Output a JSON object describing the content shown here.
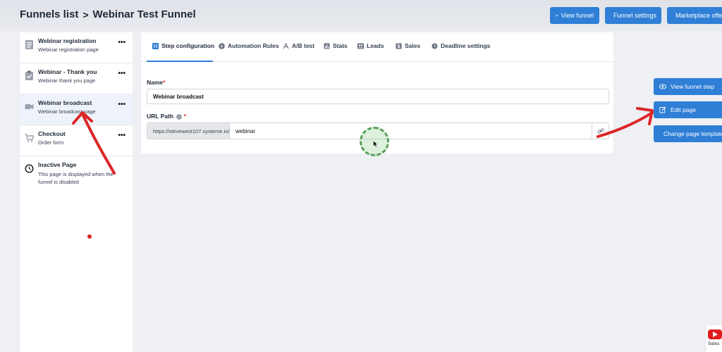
{
  "header": {
    "breadcrumb_root": "Funnels list",
    "breadcrumb_separator": ">",
    "breadcrumb_current": "Webinar Test Funnel",
    "buttons": {
      "view_funnel": "View funnel",
      "funnel_settings": "Funnel settings",
      "marketplace": "Marketplace offe"
    }
  },
  "sidebar": {
    "items": [
      {
        "title": "Webinar registration",
        "subtitle": "Webinar registration page",
        "icon": "page-icon",
        "menu": "•••"
      },
      {
        "title": "Webinar - Thank you",
        "subtitle": "Webinar thank you page",
        "icon": "clipboard-check-icon",
        "menu": "•••"
      },
      {
        "title": "Webinar broadcast",
        "subtitle": "Webinar broadcast page",
        "icon": "video-camera-icon",
        "menu": "•••"
      },
      {
        "title": "Checkout",
        "subtitle": "Order form",
        "icon": "cart-icon",
        "menu": "•••"
      },
      {
        "title": "Inactive Page",
        "subtitle": "This page is displayed when the funnel is disabled",
        "icon": "clock-icon"
      }
    ]
  },
  "tabs": [
    {
      "label": "Step configuration",
      "icon": "step-config-icon",
      "active": true
    },
    {
      "label": "Automation Rules",
      "icon": "lightning-icon"
    },
    {
      "label": "A/B test",
      "icon": "split-test-icon"
    },
    {
      "label": "Stats",
      "icon": "bar-chart-icon"
    },
    {
      "label": "Leads",
      "icon": "users-icon"
    },
    {
      "label": "Sales",
      "icon": "dollar-icon"
    },
    {
      "label": "Deadline settings",
      "icon": "clock-icon"
    }
  ],
  "form": {
    "name_label": "Name",
    "name_required": "*",
    "name_value": "Webinar broadcast",
    "url_label": "URL Path",
    "url_required": "*",
    "url_prefix": "https://stevewest107.systeme.io/",
    "url_value": "webinar"
  },
  "actions": {
    "view_step": "View funnel step",
    "edit_page": "Edit page",
    "change_template": "Change page template"
  },
  "watermark": {
    "subscribe": "Subsc"
  },
  "colors": {
    "primary": "#2f7fd6",
    "annotation": "#dc2626",
    "cursor": "#5aa05a"
  }
}
